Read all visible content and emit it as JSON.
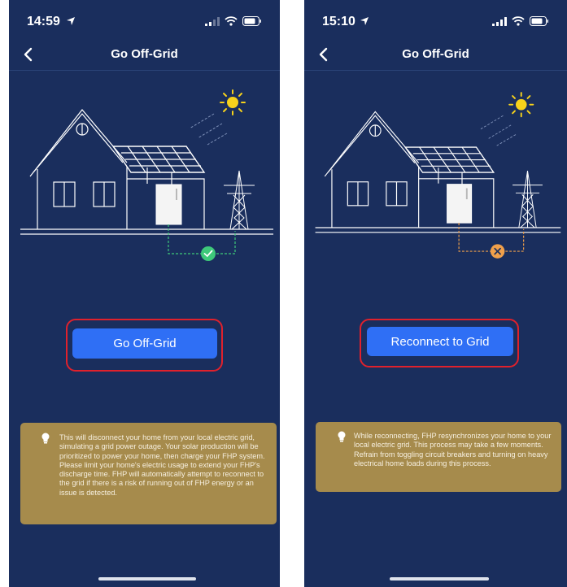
{
  "screens": [
    {
      "status": {
        "time": "14:59"
      },
      "nav": {
        "title": "Go Off-Grid"
      },
      "connection_state": "connected",
      "action_button": {
        "label": "Go Off-Grid"
      },
      "info": {
        "icon": "lightbulb-icon",
        "text": "This will disconnect your home from your local electric grid, simulating a grid power outage. Your solar production will be prioritized to power your home, then charge your FHP system. Please limit  your home's electric usage to extend your FHP's discharge time.  FHP will automatically attempt to reconnect to the grid if there is a risk of running out of FHP energy or an issue is detected."
      }
    },
    {
      "status": {
        "time": "15:10"
      },
      "nav": {
        "title": "Go Off-Grid"
      },
      "connection_state": "disconnected",
      "action_button": {
        "label": "Reconnect to Grid"
      },
      "info": {
        "icon": "lightbulb-icon",
        "text": "While reconnecting, FHP resynchronizes your home to your local electric grid. This process may take a few moments. Refrain from toggling circuit breakers and turning on heavy electrical home loads during this process."
      }
    }
  ],
  "colors": {
    "background": "#1a2e5d",
    "button": "#2f6ff5",
    "highlight": "#e0212c",
    "info_card": "#a68b4c",
    "connected": "#3ec97a",
    "disconnected": "#f0a04b",
    "sun": "#f7d21b"
  }
}
